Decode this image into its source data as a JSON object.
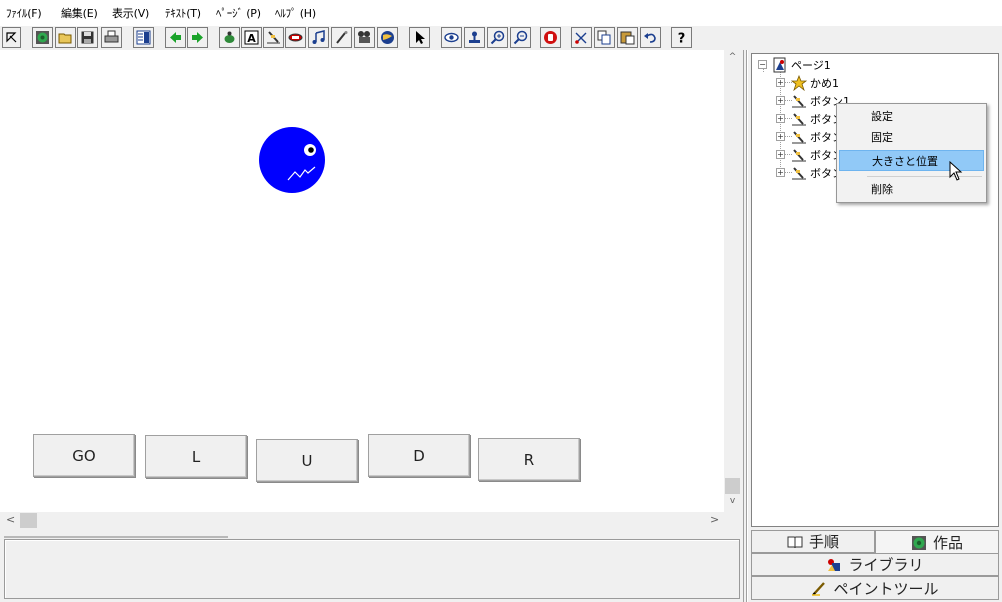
{
  "menu": [
    {
      "label": "ﾌｧｲﾙ(F)"
    },
    {
      "label": "編集(E)"
    },
    {
      "label": "表示(V)"
    },
    {
      "label": "ﾃｷｽﾄ(T)"
    },
    {
      "label": "ﾍﾟｰｼﾞ (P)"
    },
    {
      "label": "ﾍﾙﾌﾟ (H)"
    }
  ],
  "toolbar": [
    {
      "icon": "pointer-arrow-icon"
    },
    {
      "icon": "new-work-icon"
    },
    {
      "icon": "open-folder-icon"
    },
    {
      "icon": "save-disk-icon"
    },
    {
      "icon": "print-icon"
    },
    {
      "icon": "page-layout-icon"
    },
    {
      "icon": "back-arrow-icon"
    },
    {
      "icon": "forward-arrow-icon"
    },
    {
      "icon": "turtle-icon"
    },
    {
      "icon": "text-box-icon"
    },
    {
      "icon": "button-icon"
    },
    {
      "icon": "field-icon"
    },
    {
      "icon": "music-note-icon"
    },
    {
      "icon": "paint-brush-icon"
    },
    {
      "icon": "film-icon"
    },
    {
      "icon": "globe-icon"
    },
    {
      "icon": "select-arrow-icon"
    },
    {
      "icon": "eye-icon"
    },
    {
      "icon": "stamp-icon"
    },
    {
      "icon": "zoom-in-icon"
    },
    {
      "icon": "zoom-out-icon"
    },
    {
      "icon": "stop-hand-icon"
    },
    {
      "icon": "cut-scissors-icon"
    },
    {
      "icon": "copy-icon"
    },
    {
      "icon": "paste-icon"
    },
    {
      "icon": "undo-icon"
    },
    {
      "icon": "help-icon"
    }
  ],
  "canvas": {
    "buttons": [
      {
        "label": "GO"
      },
      {
        "label": "L"
      },
      {
        "label": "U"
      },
      {
        "label": "D"
      },
      {
        "label": "R"
      }
    ],
    "turtle_color": "#0000ff"
  },
  "tree": {
    "root": {
      "label": "ページ1",
      "collapse_symbol": "−"
    },
    "children": [
      {
        "label": "かめ1",
        "icon": "turtle-star-icon",
        "expand_symbol": "+"
      },
      {
        "label": "ボタン1",
        "icon": "button-icon",
        "expand_symbol": "+"
      },
      {
        "label": "ボタン",
        "icon": "button-icon",
        "expand_symbol": "+"
      },
      {
        "label": "ボタン",
        "icon": "button-icon",
        "expand_symbol": "+"
      },
      {
        "label": "ボタン",
        "icon": "button-icon",
        "expand_symbol": "+"
      },
      {
        "label": "ボタン",
        "icon": "button-icon",
        "expand_symbol": "+"
      }
    ]
  },
  "context_menu": {
    "items": [
      {
        "label": "設定"
      },
      {
        "label": "固定"
      },
      {
        "label": "大きさと位置",
        "highlighted": true
      },
      {
        "label": "削除"
      }
    ]
  },
  "tabs": {
    "procedure": {
      "label": "手順",
      "icon": "book-icon"
    },
    "work": {
      "label": "作品",
      "icon": "globe-icon"
    },
    "library": {
      "label": "ライブラリ",
      "icon": "library-icon"
    },
    "paint": {
      "label": "ペイントツール",
      "icon": "pencil-icon"
    }
  },
  "scrollbar": {
    "left_arrow": "<",
    "right_arrow": ">",
    "up_arrow": "^",
    "down_arrow": "v"
  }
}
